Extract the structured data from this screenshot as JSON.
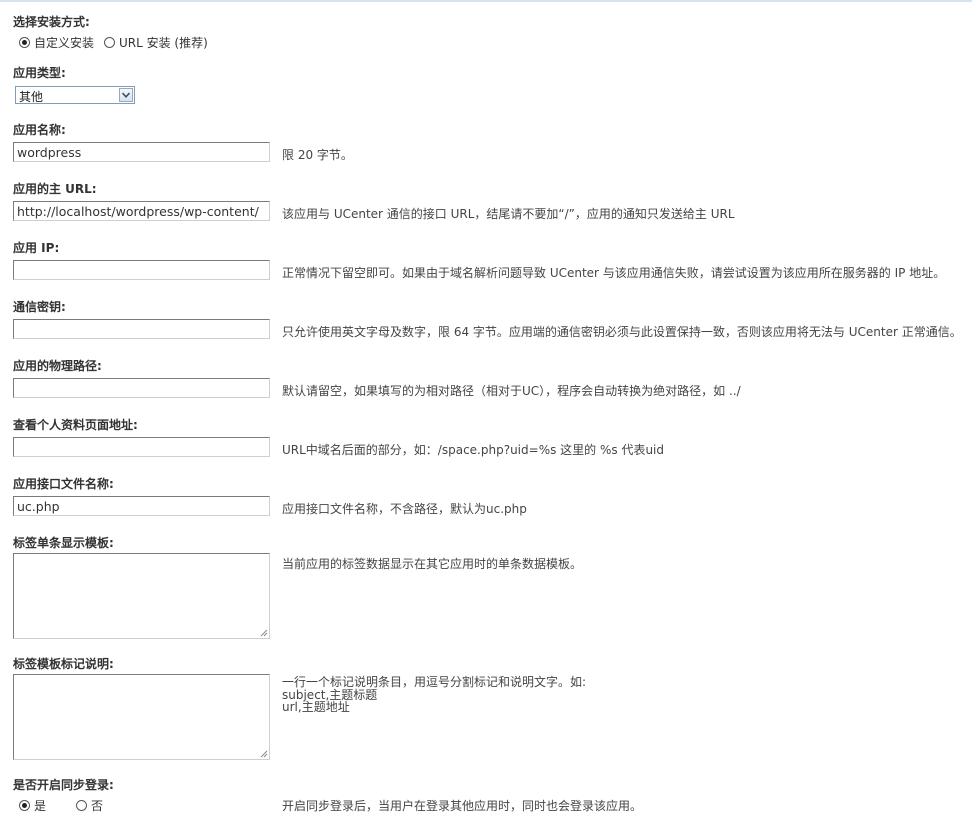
{
  "install_mode": {
    "label": "选择安装方式:",
    "options": [
      {
        "label": "自定义安装",
        "selected": true
      },
      {
        "label": "URL 安装 (推荐)",
        "selected": false
      }
    ]
  },
  "app_type": {
    "label": "应用类型:",
    "selected": "其他"
  },
  "app_name": {
    "label": "应用名称:",
    "value": "wordpress",
    "note": "限 20 字节。"
  },
  "app_url": {
    "label": "应用的主 URL:",
    "value": "http://localhost/wordpress/wp-content/",
    "note": "该应用与 UCenter 通信的接口 URL，结尾请不要加“/”，应用的通知只发送给主 URL"
  },
  "app_ip": {
    "label": "应用 IP:",
    "value": "",
    "note": "正常情况下留空即可。如果由于域名解析问题导致 UCenter 与该应用通信失败，请尝试设置为该应用所在服务器的 IP 地址。"
  },
  "auth_key": {
    "label": "通信密钥:",
    "value": "",
    "note": "只允许使用英文字母及数字，限 64 字节。应用端的通信密钥必须与此设置保持一致，否则该应用将无法与 UCenter 正常通信。"
  },
  "app_path": {
    "label": "应用的物理路径:",
    "value": "",
    "note": "默认请留空，如果填写的为相对路径（相对于UC），程序会自动转换为绝对路径，如 ../"
  },
  "profile_url": {
    "label": "查看个人资料页面地址:",
    "value": "",
    "note": "URL中域名后面的部分，如：/space.php?uid=%s 这里的 %s 代表uid"
  },
  "api_file": {
    "label": "应用接口文件名称:",
    "value": "uc.php",
    "note": "应用接口文件名称，不含路径，默认为uc.php"
  },
  "tag_template": {
    "label": "标签单条显示模板:",
    "note": "当前应用的标签数据显示在其它应用时的单条数据模板。"
  },
  "tag_fields": {
    "label": "标签模板标记说明:",
    "note_lines": [
      "一行一个标记说明条目，用逗号分割标记和说明文字。如:",
      "subject,主题标题",
      "url,主题地址"
    ]
  },
  "sync_login": {
    "label": "是否开启同步登录:",
    "options": [
      {
        "label": "是",
        "selected": true
      },
      {
        "label": "否",
        "selected": false
      }
    ],
    "note": "开启同步登录后，当用户在登录其他应用时，同时也会登录该应用。"
  }
}
